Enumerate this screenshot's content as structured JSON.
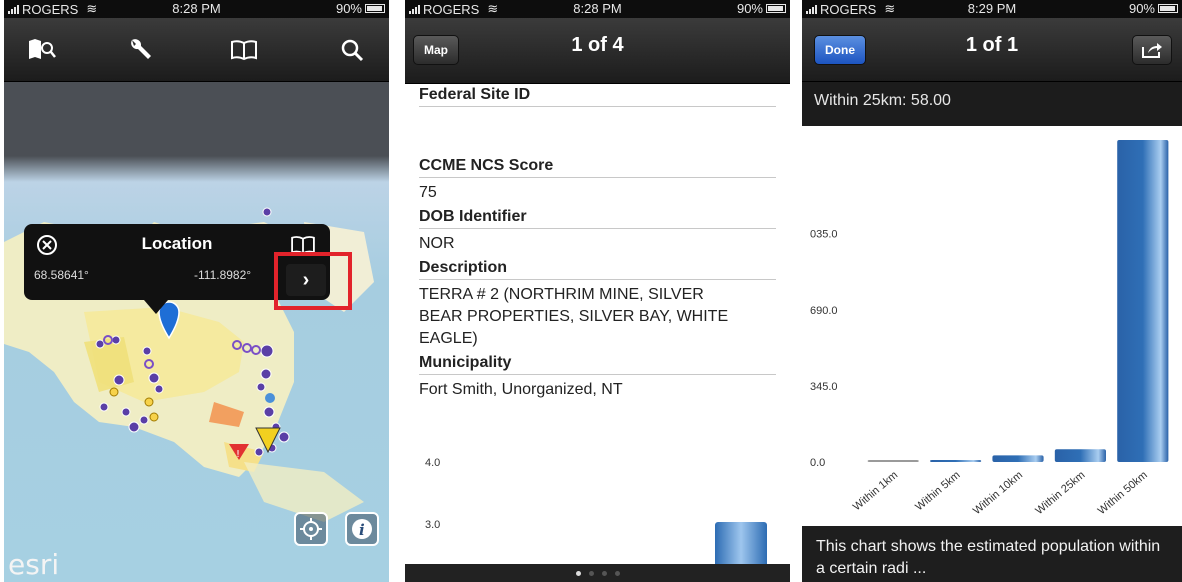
{
  "status_bars": [
    {
      "carrier": "ROGERS",
      "time": "8:28 PM",
      "battery": "90%"
    },
    {
      "carrier": "ROGERS",
      "time": "8:28 PM",
      "battery": "90%"
    },
    {
      "carrier": "ROGERS",
      "time": "8:29 PM",
      "battery": "90%"
    }
  ],
  "map_screen": {
    "toolbar_icons": [
      "map-search-icon",
      "wrench-icon",
      "book-icon",
      "search-icon"
    ],
    "callout": {
      "title": "Location",
      "latitude": "68.58641°",
      "longitude": "-111.8982°",
      "chevron": "›"
    },
    "logo": "esri",
    "buttons": [
      "locate-icon",
      "info-icon"
    ]
  },
  "detail_screen": {
    "back_button": "Map",
    "title": "1 of 4",
    "fields": [
      {
        "label": "Federal Site ID",
        "value": ""
      },
      {
        "label": "CCME NCS Score",
        "value": "75"
      },
      {
        "label": "DOB Identifier",
        "value": "NOR"
      },
      {
        "label": "Description",
        "value": "TERRA # 2 (NORTHRIM MINE, SILVER BEAR PROPERTIES, SILVER BAY, WHITE EAGLE)"
      },
      {
        "label": "Municipality",
        "value": "Fort Smith, Unorganized, NT"
      }
    ],
    "chart_y_ticks": [
      "4.0",
      "3.0"
    ],
    "page_count": 4,
    "page_current": 1
  },
  "chart_screen": {
    "done_button": "Done",
    "title": "1 of 1",
    "tooltip": "Within 25km: 58.00",
    "caption": "This chart shows the estimated population within a certain radi ...",
    "accent_color": "#2f6fb6"
  },
  "chart_data": {
    "type": "bar",
    "title": "",
    "xlabel": "",
    "ylabel": "",
    "categories": [
      "Within 1km",
      "Within 5km",
      "Within 10km",
      "Within 25km",
      "Within 50km"
    ],
    "values": [
      0,
      8,
      30,
      58,
      1460
    ],
    "y_tick_labels": [
      "0.0",
      "345.0",
      "690.0",
      "035.0"
    ],
    "y_tick_values": [
      0,
      345,
      690,
      1035
    ],
    "ylim": [
      0,
      1460
    ],
    "grid": false
  }
}
